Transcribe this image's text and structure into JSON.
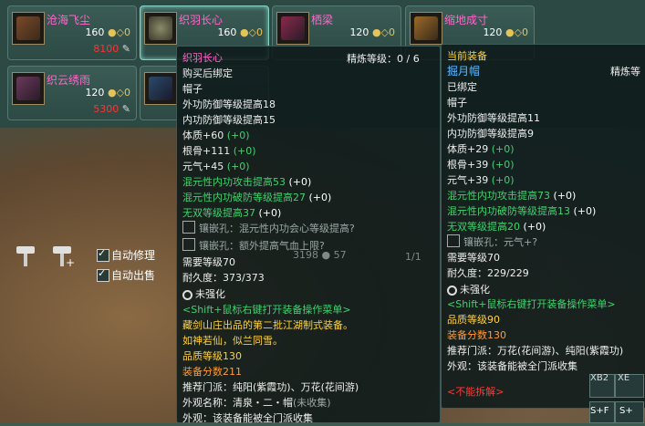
{
  "shop": {
    "items": [
      {
        "name": "沧海飞尘",
        "price": "160",
        "stock": "8100"
      },
      {
        "name": "织羽长心",
        "price": "160",
        "stock": ""
      },
      {
        "name": "栖梁",
        "price": "120",
        "stock": ""
      },
      {
        "name": "缩地成寸",
        "price": "120",
        "stock": ""
      },
      {
        "name": "织云绣雨",
        "price": "120",
        "stock": "5300"
      },
      {
        "name": "",
        "price": "120",
        "stock": ""
      }
    ],
    "auto_repair_label": "自动修理",
    "auto_sell_label": "自动出售",
    "pager": "1/1",
    "money_a": "3198",
    "money_b": "57"
  },
  "left_tip": {
    "title": "织羽长心",
    "refine": "精炼等级：0 / 6",
    "bind": "购买后绑定",
    "type": "帽子",
    "stats": [
      "外功防御等级提高18",
      "内功防御等级提高15"
    ],
    "attrs": [
      {
        "label": "体质+60",
        "extra": "(+0)"
      },
      {
        "label": "根骨+111",
        "extra": "(+0)"
      },
      {
        "label": "元气+45",
        "extra": "(+0)"
      }
    ],
    "green_attrs": [
      {
        "label": "混元性内功攻击提高53",
        "extra": "(+0)"
      },
      {
        "label": "混元性内功破防等级提高27",
        "extra": "(+0)"
      },
      {
        "label": "无双等级提高37",
        "extra": "(+0)"
      }
    ],
    "sockets": [
      "镶嵌孔：混元性内功会心等级提高?",
      "镶嵌孔：额外提高气血上限?"
    ],
    "req_level": "需要等级70",
    "durability": "耐久度：373/373",
    "enchant": "未强化",
    "hint": "<Shift+鼠标右键打开装备操作菜单>",
    "desc1": "藏剑山庄出品的第二批江湖制式装备。",
    "desc2": "如神若仙，似兰同雪。",
    "quality": "品质等级130",
    "score": "装备分数211",
    "school": "推荐门派：纯阳(紫霞功)、万花(花间游)",
    "look_name": "外观名称：清泉・二・帽",
    "look_status": "(未收集)",
    "look": "外观：该装备能被全门派收集"
  },
  "right_tip": {
    "header": "当前装备",
    "title": "掘月帽",
    "refine": "精炼等",
    "bind": "已绑定",
    "type": "帽子",
    "stats": [
      "外功防御等级提高11",
      "内功防御等级提高9"
    ],
    "attrs": [
      {
        "label": "体质+29",
        "extra": "(+0)"
      },
      {
        "label": "根骨+39",
        "extra": "(+0)"
      },
      {
        "label": "元气+39",
        "extra": "(+0)"
      }
    ],
    "green_attrs": [
      {
        "label": "混元性内功攻击提高73",
        "extra": "(+0)"
      },
      {
        "label": "混元性内功破防等级提高13",
        "extra": "(+0)"
      },
      {
        "label": "无双等级提高20",
        "extra": "(+0)"
      }
    ],
    "socket": "镶嵌孔：元气+?",
    "req_level": "需要等级70",
    "durability": "耐久度：229/229",
    "enchant": "未强化",
    "hint": "<Shift+鼠标右键打开装备操作菜单>",
    "quality": "品质等级90",
    "score": "装备分数130",
    "school": "推荐门派：万花(花间游)、纯阳(紫霞功)",
    "look": "外观：该装备能被全门派收集",
    "no_dismantle": "<不能拆解>"
  },
  "corner": {
    "a": "XB2",
    "b": "XE",
    "c": "S+F",
    "d": "S+"
  }
}
